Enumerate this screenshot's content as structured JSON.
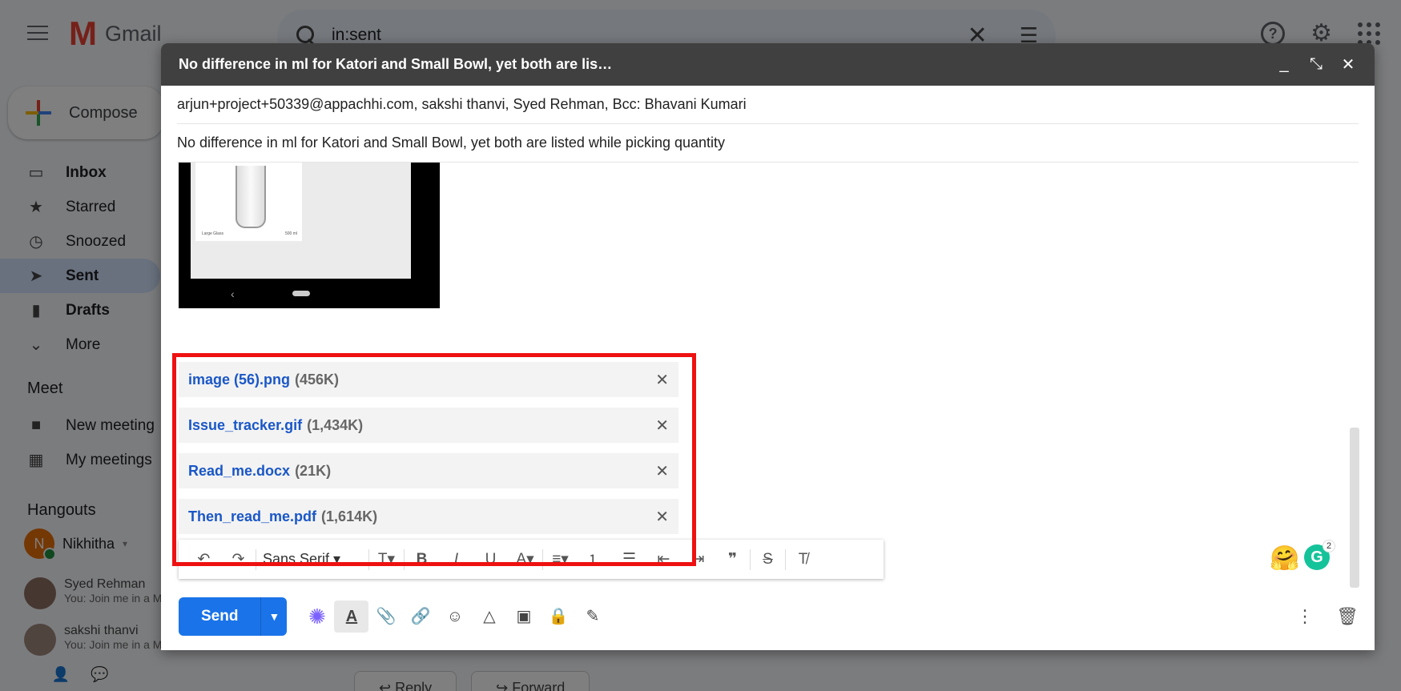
{
  "app": {
    "logo_letter": "M",
    "logo_text": "Gmail"
  },
  "search": {
    "query": "in:sent"
  },
  "sidebar": {
    "compose_label": "Compose",
    "items": [
      {
        "label": "Inbox",
        "icon": "inbox-icon",
        "glyph": "▭"
      },
      {
        "label": "Starred",
        "icon": "star-icon",
        "glyph": "★"
      },
      {
        "label": "Snoozed",
        "icon": "clock-icon",
        "glyph": "◷"
      },
      {
        "label": "Sent",
        "icon": "send-icon",
        "glyph": "➤"
      },
      {
        "label": "Drafts",
        "icon": "file-icon",
        "glyph": "▮"
      },
      {
        "label": "More",
        "icon": "chevron-down-icon",
        "glyph": "⌄"
      }
    ],
    "meet_title": "Meet",
    "meet_items": [
      {
        "label": "New meeting",
        "icon": "video-icon",
        "glyph": "■"
      },
      {
        "label": "My meetings",
        "icon": "calendar-icon",
        "glyph": "▦"
      }
    ],
    "hangouts_title": "Hangouts",
    "hangouts_user": {
      "initial": "N",
      "name": "Nikhitha",
      "caret": "▾"
    },
    "contacts": [
      {
        "name": "Syed Rehman",
        "preview": "You: Join me in a Meet video call"
      },
      {
        "name": "sakshi thanvi",
        "preview": "You: Join me in a Meet video call."
      }
    ]
  },
  "background": {
    "reply_label": "Reply",
    "forward_label": "Forward"
  },
  "compose": {
    "title": "No difference in ml for Katori and Small Bowl, yet both are lis…",
    "recipients": "arjun+project+50339@appachhi.com, sakshi thanvi, Syed Rehman, Bcc: Bhavani Kumari",
    "subject": "No difference in ml for Katori and Small Bowl, yet both are listed while picking quantity",
    "image_caption_left": "Large Glass",
    "image_caption_right": "500 ml",
    "attachments": [
      {
        "name": "image (56).png",
        "size": "(456K)"
      },
      {
        "name": "Issue_tracker.gif",
        "size": "(1,434K)"
      },
      {
        "name": "Read_me.docx",
        "size": "(21K)"
      },
      {
        "name": "Then_read_me.pdf",
        "size": "(1,614K)"
      }
    ],
    "font_name": "Sans Serif",
    "grammarly_count": "2",
    "send_label": "Send"
  }
}
